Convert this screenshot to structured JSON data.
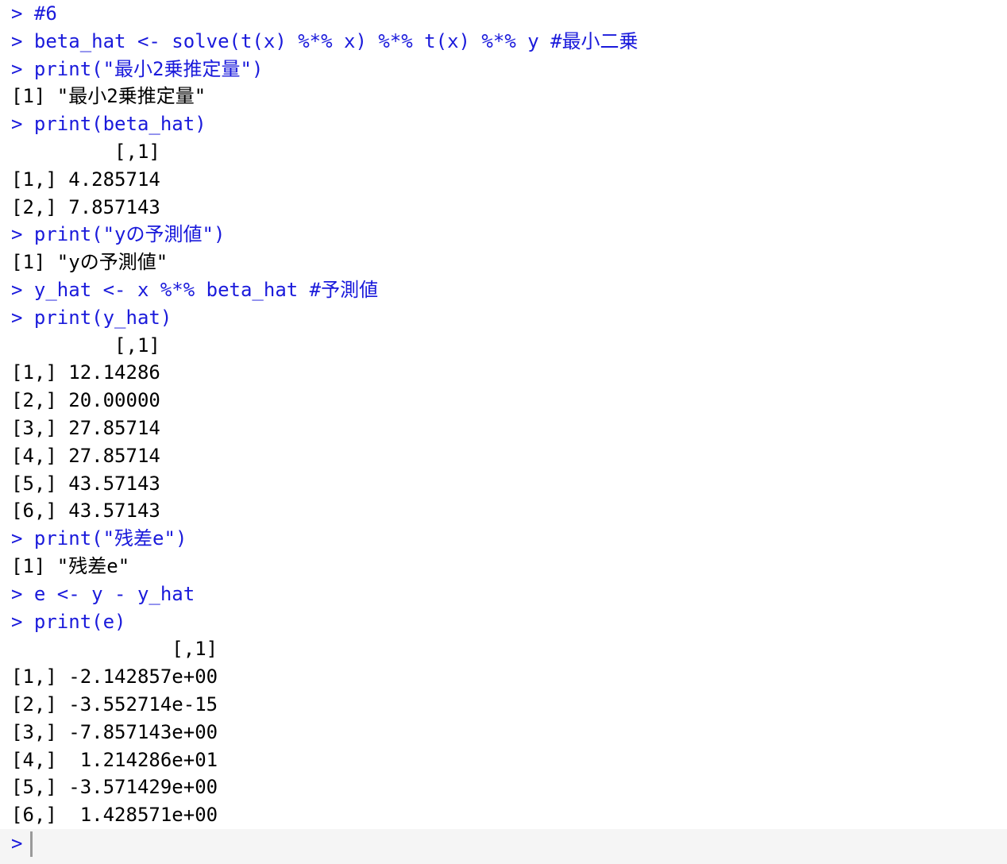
{
  "console": {
    "lines": [
      {
        "kind": "cmd",
        "text": "> #6"
      },
      {
        "kind": "cmd",
        "text": "> beta_hat <- solve(t(x) %*% x) %*% t(x) %*% y #最小二乗"
      },
      {
        "kind": "cmd",
        "text": "> print(\"最小2乗推定量\")"
      },
      {
        "kind": "out",
        "text": "[1] \"最小2乗推定量\""
      },
      {
        "kind": "cmd",
        "text": "> print(beta_hat)"
      },
      {
        "kind": "out",
        "text": "         [,1]"
      },
      {
        "kind": "out",
        "text": "[1,] 4.285714"
      },
      {
        "kind": "out",
        "text": "[2,] 7.857143"
      },
      {
        "kind": "cmd",
        "text": "> print(\"yの予測値\")"
      },
      {
        "kind": "out",
        "text": "[1] \"yの予測値\""
      },
      {
        "kind": "cmd",
        "text": "> y_hat <- x %*% beta_hat #予測値"
      },
      {
        "kind": "cmd",
        "text": "> print(y_hat)"
      },
      {
        "kind": "out",
        "text": "         [,1]"
      },
      {
        "kind": "out",
        "text": "[1,] 12.14286"
      },
      {
        "kind": "out",
        "text": "[2,] 20.00000"
      },
      {
        "kind": "out",
        "text": "[3,] 27.85714"
      },
      {
        "kind": "out",
        "text": "[4,] 27.85714"
      },
      {
        "kind": "out",
        "text": "[5,] 43.57143"
      },
      {
        "kind": "out",
        "text": "[6,] 43.57143"
      },
      {
        "kind": "cmd",
        "text": "> print(\"残差e\")"
      },
      {
        "kind": "out",
        "text": "[1] \"残差e\""
      },
      {
        "kind": "cmd",
        "text": "> e <- y - y_hat"
      },
      {
        "kind": "cmd",
        "text": "> print(e)"
      },
      {
        "kind": "out",
        "text": "              [,1]"
      },
      {
        "kind": "out",
        "text": "[1,] -2.142857e+00"
      },
      {
        "kind": "out",
        "text": "[2,] -3.552714e-15"
      },
      {
        "kind": "out",
        "text": "[3,] -7.857143e+00"
      },
      {
        "kind": "out",
        "text": "[4,]  1.214286e+01"
      },
      {
        "kind": "out",
        "text": "[5,] -3.571429e+00"
      },
      {
        "kind": "out",
        "text": "[6,]  1.428571e+00"
      }
    ],
    "prompt": ">"
  },
  "colors": {
    "command": "#1a1adb",
    "output": "#000000",
    "background": "#ffffff",
    "prompt_bar": "#f5f5f5"
  }
}
